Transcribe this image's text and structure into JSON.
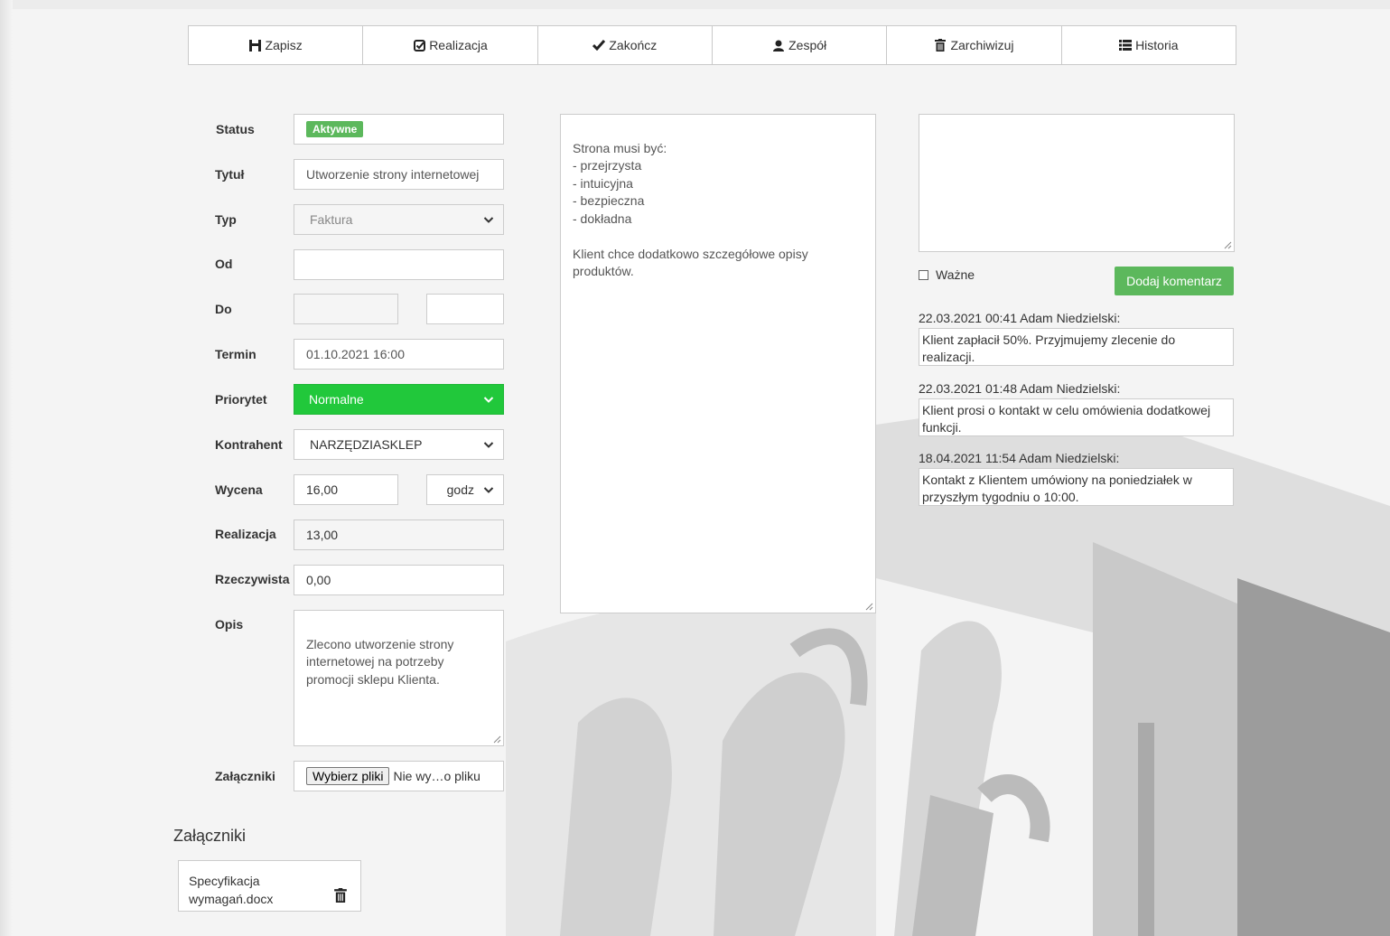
{
  "toolbar": {
    "buttons": [
      {
        "label": "Zapisz",
        "icon": "save-icon"
      },
      {
        "label": "Realizacja",
        "icon": "check-square-icon"
      },
      {
        "label": "Zakończ",
        "icon": "check-icon"
      },
      {
        "label": "Zespół",
        "icon": "user-icon"
      },
      {
        "label": "Zarchiwizuj",
        "icon": "trash-icon"
      },
      {
        "label": "Historia",
        "icon": "list-icon"
      }
    ]
  },
  "form": {
    "status": {
      "label": "Status",
      "value": "Aktywne",
      "color": "#5cb85c"
    },
    "title": {
      "label": "Tytuł",
      "value": "Utworzenie strony internetowej"
    },
    "type": {
      "label": "Typ",
      "value": "Faktura"
    },
    "from": {
      "label": "Od",
      "value": ""
    },
    "to": {
      "label": "Do",
      "value_date": "",
      "value_time": ""
    },
    "deadline": {
      "label": "Termin",
      "value": "01.10.2021 16:00"
    },
    "priority": {
      "label": "Priorytet",
      "value": "Normalne",
      "color": "#21c83b"
    },
    "contractor": {
      "label": "Kontrahent",
      "value": "NARZĘDZIASKLEP"
    },
    "estimate": {
      "label": "Wycena",
      "value": "16,00",
      "unit": "godz"
    },
    "realization": {
      "label": "Realizacja",
      "value": "13,00"
    },
    "actual": {
      "label": "Rzeczywista",
      "value": "0,00"
    },
    "description": {
      "label": "Opis",
      "value": "Zlecono utworzenie strony internetowej na potrzeby promocji sklepu Klienta."
    },
    "attachments": {
      "label": "Załączniki",
      "button": "Wybierz pliki",
      "status": "Nie wy…o pliku"
    }
  },
  "notes": {
    "text": "Strona musi być:\n- przejrzysta\n- intuicyjna\n- bezpieczna\n- dokładna\n\nKlient chce dodatkowo szczegółowe opisy produktów."
  },
  "comments": {
    "input_value": "",
    "important_label": "Ważne",
    "add_button": "Dodaj komentarz",
    "items": [
      {
        "header": "22.03.2021 00:41 Adam Niedzielski:",
        "text": "Klient zapłacił 50%. Przyjmujemy zlecenie do realizacji."
      },
      {
        "header": "22.03.2021 01:48 Adam Niedzielski:",
        "text": "Klient prosi o kontakt w celu omówienia dodatkowej funkcji."
      },
      {
        "header": "18.04.2021 11:54 Adam Niedzielski:",
        "text": "Kontakt z Klientem umówiony na poniedziałek w przyszłym tygodniu o 10:00."
      }
    ]
  },
  "attachments_section": {
    "heading": "Załączniki",
    "files": [
      {
        "name": "Specyfikacja wymagań.docx"
      }
    ]
  }
}
